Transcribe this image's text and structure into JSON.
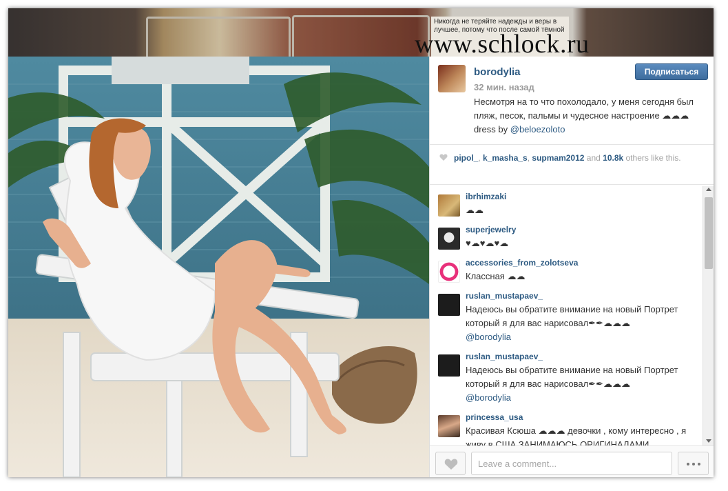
{
  "watermark": "www.schlock.ru",
  "background_quote": "Никогда не теряйте надежды и веры в лучшее, потому что после самой тёмной",
  "post": {
    "username": "borodylia",
    "follow_label": "Подписаться",
    "time": "32 мин. назад",
    "caption": "Несмотря на то что похолодало, у меня сегодня был пляж, песок, пальмы и чудесное настроение",
    "caption_emoji": "☁☁☁",
    "caption_dress": " dress by ",
    "caption_mention": "@beloezoloto"
  },
  "likes": {
    "users": [
      "pipol_",
      "k_masha_s",
      "supmam2012"
    ],
    "and_label": "and",
    "count": "10.8k",
    "suffix": "others like this."
  },
  "comments": [
    {
      "user": "ibrhimzaki",
      "text": "☁☁"
    },
    {
      "user": "superjewelry",
      "text": "♥☁♥☁♥☁"
    },
    {
      "user": "accessories_from_zolotseva",
      "text": "Классная ☁☁"
    },
    {
      "user": "ruslan_mustapaev_",
      "text": "Надеюсь вы обратите внимание на новый Портрет который я для вас нарисовал✒✒☁☁☁",
      "mention": "@borodylia"
    },
    {
      "user": "ruslan_mustapaev_",
      "text": "Надеюсь вы обратите внимание на новый Портрет который я для вас нарисовал✒✒☁☁☁",
      "mention": "@borodylia"
    },
    {
      "user": "princessa_usa",
      "text": "Красивая Ксюша ☁☁☁ девочки , кому интересно , я живу в США ЗАНИМАЮСЬ ОРИГИНАЛАМИ"
    }
  ],
  "footer": {
    "comment_placeholder": "Leave a comment..."
  },
  "colors": {
    "link": "#2d5a82",
    "follow_button": "#3e6d9e",
    "meta_gray": "#9a9a9a"
  }
}
